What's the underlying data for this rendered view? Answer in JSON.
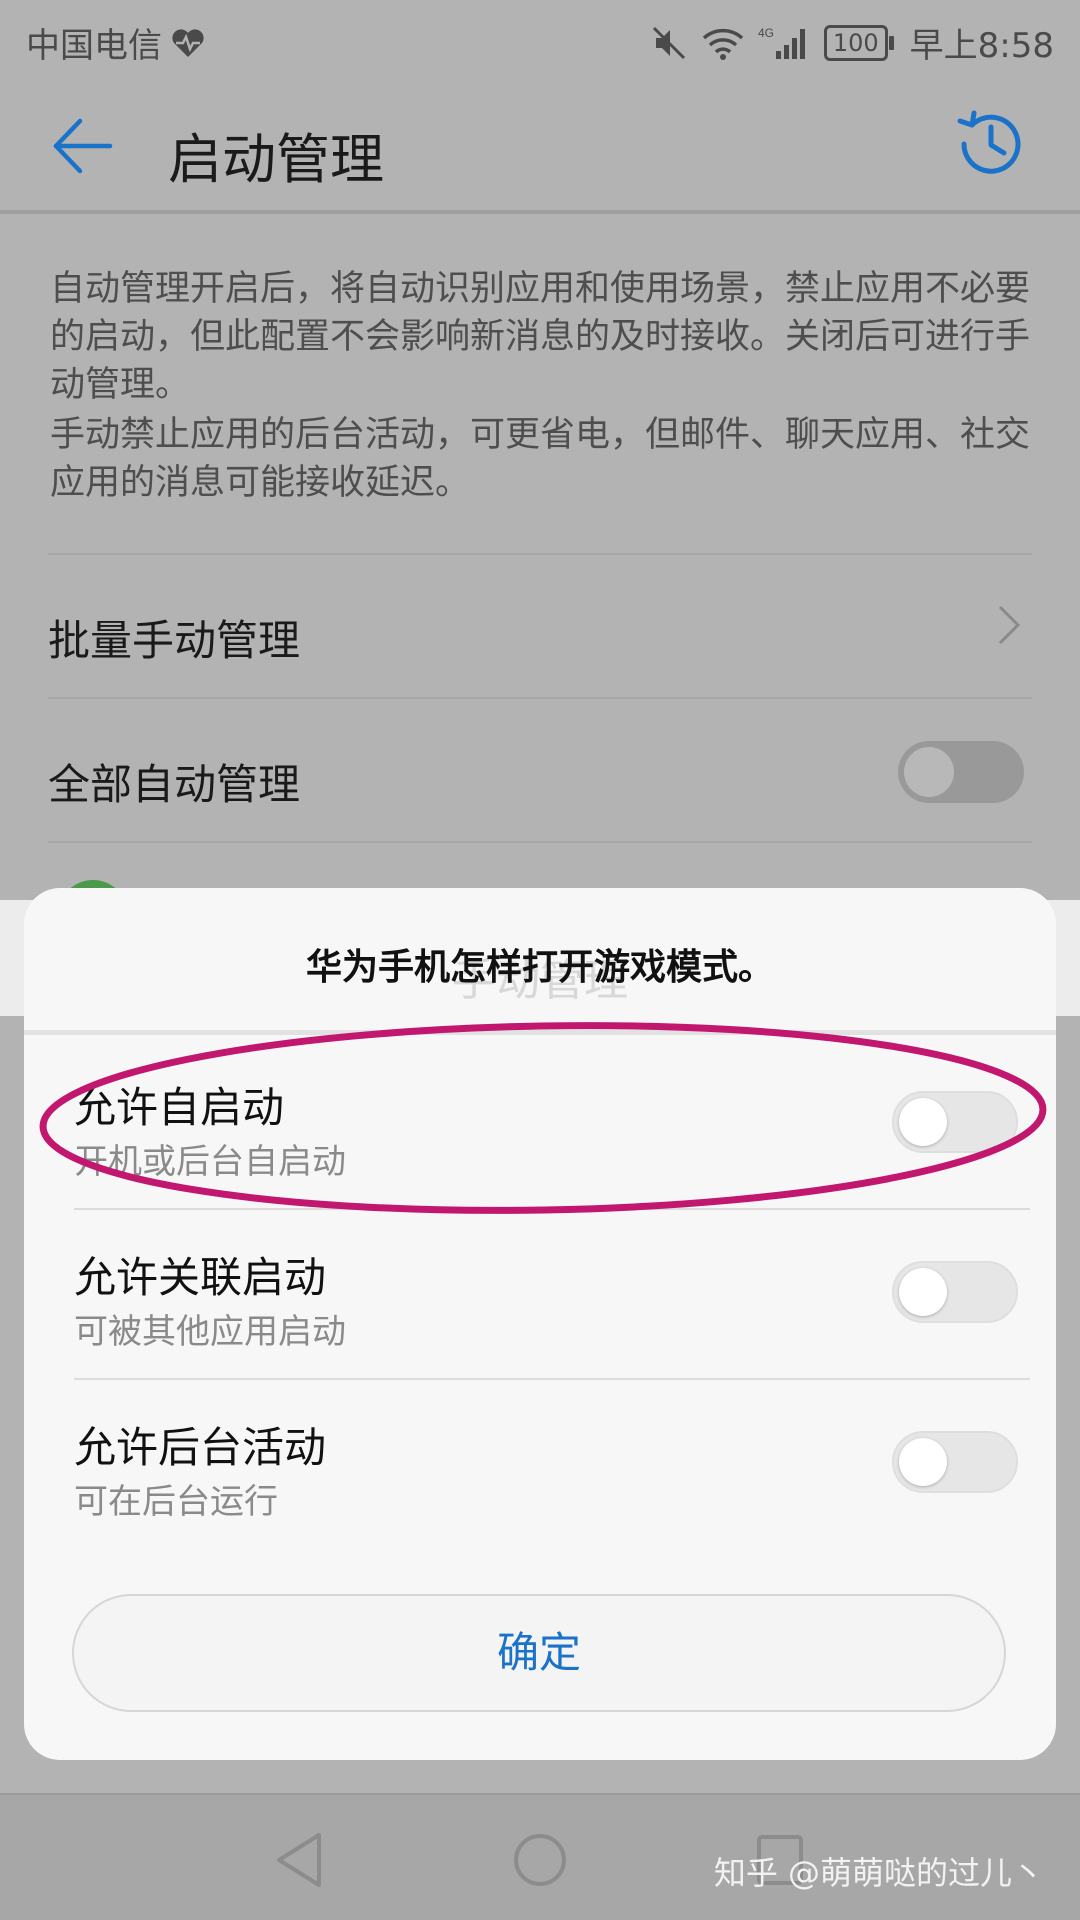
{
  "status_bar": {
    "carrier": "中国电信",
    "battery": "100",
    "time": "早上8:58",
    "icons": [
      "heart-pulse-icon",
      "mute-icon",
      "wifi-icon",
      "signal-4g-icon"
    ]
  },
  "app_bar": {
    "title": "启动管理",
    "icons": [
      "back-arrow-icon",
      "history-clock-icon"
    ]
  },
  "description": {
    "para1": "自动管理开启后，将自动识别应用和使用场景，禁止应用不必要的启动，但此配置不会影响新消息的及时接收。关闭后可进行手动管理。",
    "para2": "手动禁止应用的后台活动，可更省电，但邮件、聊天应用、社交应用的消息可能接收延迟。"
  },
  "list": {
    "batch_label": "批量手动管理",
    "all_auto_label": "全部自动管理"
  },
  "dialog": {
    "title": "华为手机怎样打开游戏模式。",
    "ghost_title": "手动管理",
    "options": [
      {
        "title": "允许自启动",
        "subtitle": "开机或后台自启动",
        "enabled": false
      },
      {
        "title": "允许关联启动",
        "subtitle": "可被其他应用启动",
        "enabled": false
      },
      {
        "title": "允许后台活动",
        "subtitle": "可在后台运行",
        "enabled": false
      }
    ],
    "confirm": "确定"
  },
  "colors": {
    "accent": "#1a73c9",
    "annotation": "#c2176f"
  },
  "watermark": "知乎 @萌萌哒的过儿丶"
}
